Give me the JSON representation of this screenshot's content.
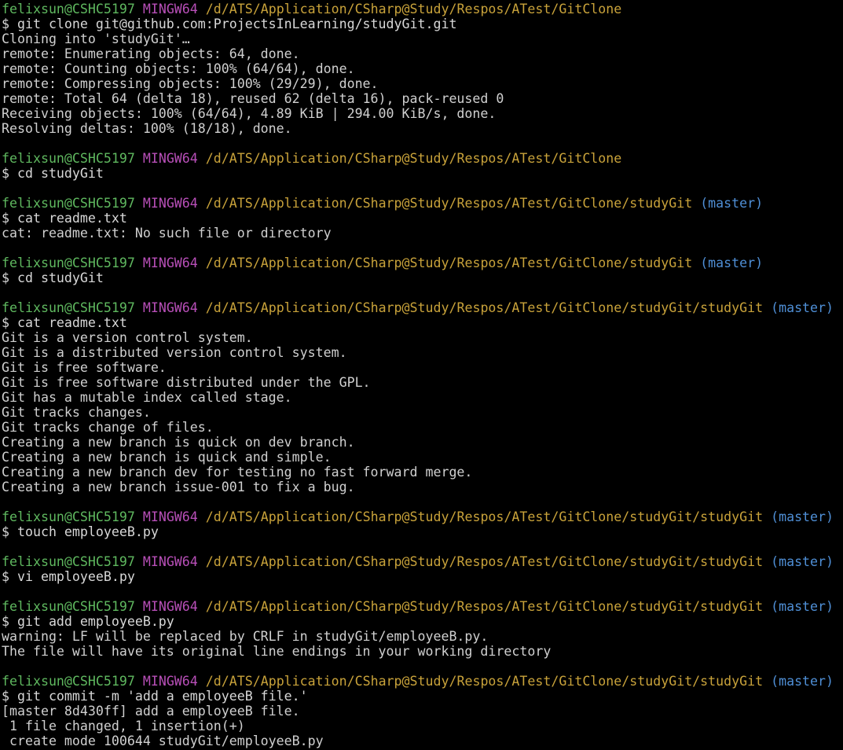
{
  "colors": {
    "background": "#000000",
    "user_host": "#5fb85f",
    "system": "#b84fb8",
    "path": "#c8a23a",
    "branch": "#4f8fd6",
    "text": "#d0d0d0"
  },
  "blocks": [
    {
      "prompt": {
        "user": "felixsun@CSHC5197",
        "system": "MINGW64",
        "path": "/d/ATS/Application/CSharp@Study/Respos/ATest/GitClone",
        "branch": ""
      },
      "command": "$ git clone git@github.com:ProjectsInLearning/studyGit.git",
      "output": [
        "Cloning into 'studyGit'…",
        "remote: Enumerating objects: 64, done.",
        "remote: Counting objects: 100% (64/64), done.",
        "remote: Compressing objects: 100% (29/29), done.",
        "remote: Total 64 (delta 18), reused 62 (delta 16), pack-reused 0",
        "Receiving objects: 100% (64/64), 4.89 KiB | 294.00 KiB/s, done.",
        "Resolving deltas: 100% (18/18), done."
      ]
    },
    {
      "prompt": {
        "user": "felixsun@CSHC5197",
        "system": "MINGW64",
        "path": "/d/ATS/Application/CSharp@Study/Respos/ATest/GitClone",
        "branch": ""
      },
      "command": "$ cd studyGit",
      "output": []
    },
    {
      "prompt": {
        "user": "felixsun@CSHC5197",
        "system": "MINGW64",
        "path": "/d/ATS/Application/CSharp@Study/Respos/ATest/GitClone/studyGit",
        "branch": "(master)"
      },
      "command": "$ cat readme.txt",
      "output": [
        "cat: readme.txt: No such file or directory"
      ]
    },
    {
      "prompt": {
        "user": "felixsun@CSHC5197",
        "system": "MINGW64",
        "path": "/d/ATS/Application/CSharp@Study/Respos/ATest/GitClone/studyGit",
        "branch": "(master)"
      },
      "command": "$ cd studyGit",
      "output": []
    },
    {
      "prompt": {
        "user": "felixsun@CSHC5197",
        "system": "MINGW64",
        "path": "/d/ATS/Application/CSharp@Study/Respos/ATest/GitClone/studyGit/studyGit",
        "branch": "(master)"
      },
      "command": "$ cat readme.txt",
      "output": [
        "Git is a version control system.",
        "Git is a distributed version control system.",
        "Git is free software.",
        "Git is free software distributed under the GPL.",
        "Git has a mutable index called stage.",
        "Git tracks changes.",
        "Git tracks change of files.",
        "Creating a new branch is quick on dev branch.",
        "Creating a new branch is quick and simple.",
        "Creating a new branch dev for testing no fast forward merge.",
        "Creating a new branch issue-001 to fix a bug."
      ]
    },
    {
      "prompt": {
        "user": "felixsun@CSHC5197",
        "system": "MINGW64",
        "path": "/d/ATS/Application/CSharp@Study/Respos/ATest/GitClone/studyGit/studyGit",
        "branch": "(master)"
      },
      "command": "$ touch employeeB.py",
      "output": []
    },
    {
      "prompt": {
        "user": "felixsun@CSHC5197",
        "system": "MINGW64",
        "path": "/d/ATS/Application/CSharp@Study/Respos/ATest/GitClone/studyGit/studyGit",
        "branch": "(master)"
      },
      "command": "$ vi employeeB.py",
      "output": []
    },
    {
      "prompt": {
        "user": "felixsun@CSHC5197",
        "system": "MINGW64",
        "path": "/d/ATS/Application/CSharp@Study/Respos/ATest/GitClone/studyGit/studyGit",
        "branch": "(master)"
      },
      "command": "$ git add employeeB.py",
      "output": [
        "warning: LF will be replaced by CRLF in studyGit/employeeB.py.",
        "The file will have its original line endings in your working directory"
      ]
    },
    {
      "prompt": {
        "user": "felixsun@CSHC5197",
        "system": "MINGW64",
        "path": "/d/ATS/Application/CSharp@Study/Respos/ATest/GitClone/studyGit/studyGit",
        "branch": "(master)"
      },
      "command": "$ git commit -m 'add a employeeB file.'",
      "output": [
        "[master 8d430ff] add a employeeB file.",
        " 1 file changed, 1 insertion(+)",
        " create mode 100644 studyGit/employeeB.py"
      ]
    }
  ]
}
